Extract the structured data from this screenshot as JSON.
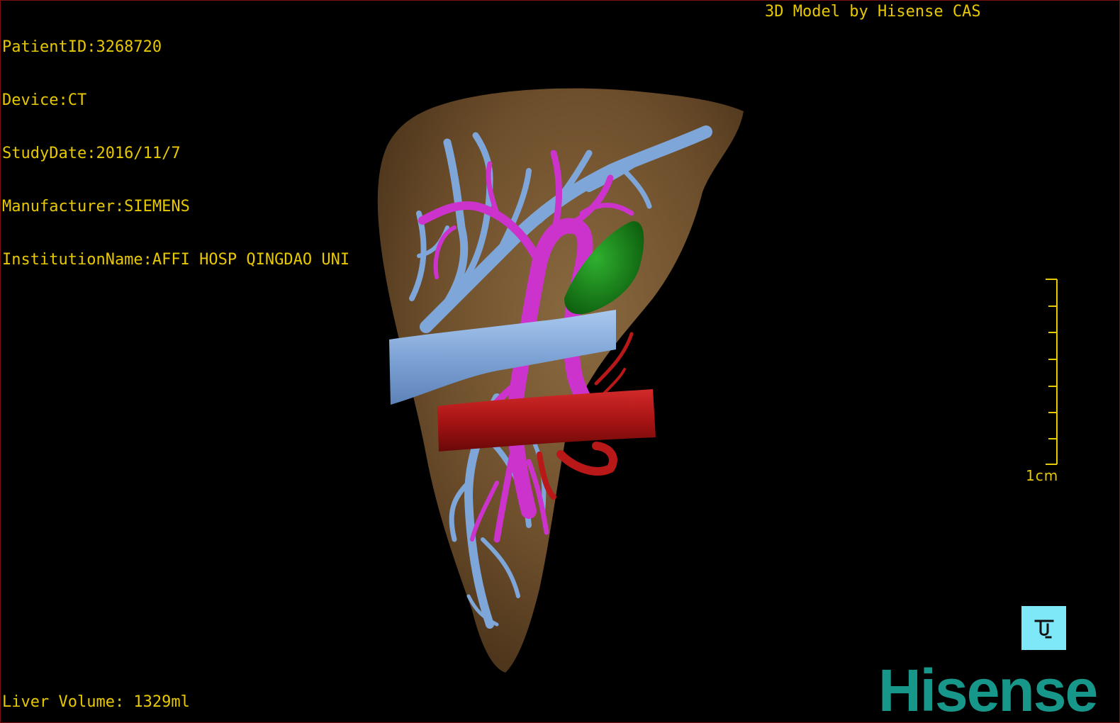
{
  "patient_info": {
    "patient_id": "PatientID:3268720",
    "device": "Device:CT",
    "study_date": "StudyDate:2016/11/7",
    "manufacturer": "Manufacturer:SIEMENS",
    "institution": "InstitutionName:AFFI HOSP QINGDAO UNI"
  },
  "header": {
    "model_label": "3D Model by Hisense CAS"
  },
  "footer": {
    "liver_volume": "Liver Volume: 1329ml"
  },
  "scale_bar": {
    "label": "1cm"
  },
  "orientation_button": {
    "icon": "orientation-cube-icon"
  },
  "brand": {
    "logo_text": "Hisense"
  },
  "colors": {
    "overlay_text": "#e8c800",
    "liver": "#7a5a33",
    "hepatic_vein": "#7fa6d8",
    "portal_vein": "#cc33cc",
    "artery": "#b81818",
    "gallbladder": "#1a8a1a",
    "orientation_button": "#7fe8f8",
    "brand": "#17968a"
  }
}
